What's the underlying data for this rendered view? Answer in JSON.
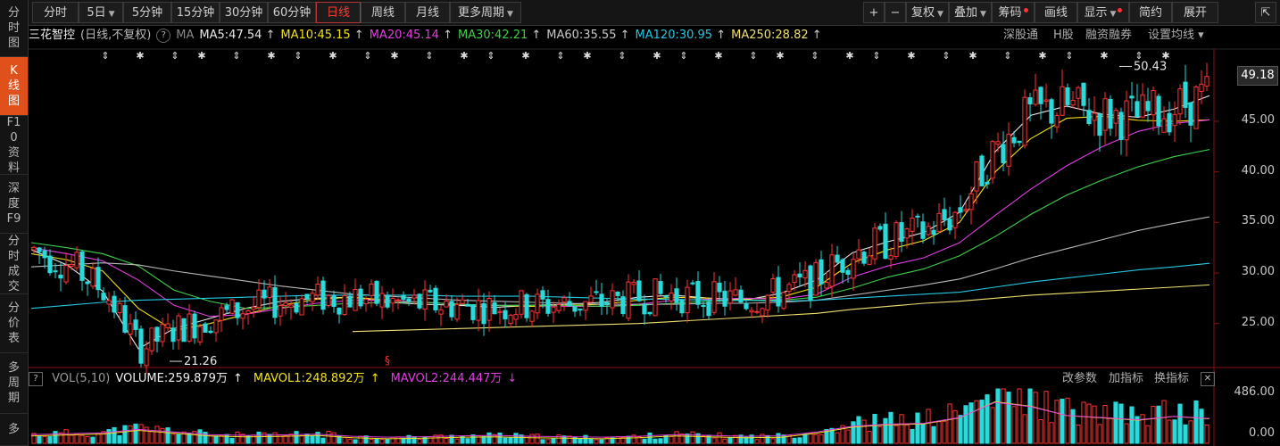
{
  "left_nav": [
    {
      "label": "分时图"
    },
    {
      "label": "K线图",
      "active": true
    },
    {
      "label": "F10资料"
    },
    {
      "label": "深度F9"
    },
    {
      "label": "分时成交"
    },
    {
      "label": "分价表"
    },
    {
      "label": "多周期"
    },
    {
      "label": "多"
    }
  ],
  "toolbar": {
    "periods": [
      "分时",
      "5日",
      "5分钟",
      "15分钟",
      "30分钟",
      "60分钟",
      "日线",
      "周线",
      "月线",
      "更多周期"
    ],
    "active_period": "日线",
    "right_buttons": [
      "+",
      "−",
      "复权",
      "叠加",
      "筹码",
      "画线",
      "显示",
      "简约",
      "展开"
    ]
  },
  "ma_line": {
    "stock_name": "三花智控",
    "mode": "(日线,不复权)",
    "help": "?",
    "ma_label": "MA",
    "items": [
      {
        "text": "MA5:47.54",
        "arrow": "↑",
        "color": "#e8e8e8"
      },
      {
        "text": "MA10:45.15",
        "arrow": "↑",
        "color": "#f2e21c"
      },
      {
        "text": "MA20:45.14",
        "arrow": "↑",
        "color": "#e23ee2"
      },
      {
        "text": "MA30:42.21",
        "arrow": "↑",
        "color": "#3ed24a"
      },
      {
        "text": "MA60:35.55",
        "arrow": "↑",
        "color": "#c8c8c8"
      },
      {
        "text": "MA120:30.95",
        "arrow": "↑",
        "color": "#24c8e0"
      },
      {
        "text": "MA250:28.82",
        "arrow": "↑",
        "color": "#f0e070"
      }
    ],
    "right_links": [
      "深股通",
      "H股",
      "融资融券",
      "设置均线"
    ]
  },
  "price_axis": [
    "45.00",
    "40.00",
    "35.00",
    "30.00",
    "25.00"
  ],
  "current_price": "49.18",
  "annotations": {
    "high": "50.43",
    "low": "21.26"
  },
  "volume_header": {
    "label": "VOL(5,10)",
    "volume": "VOLUME:259.879万",
    "mavol1": "MAVOL1:248.892万",
    "mavol2": "MAVOL2:244.447万",
    "arrow_up": "↑",
    "arrow_down": "↓",
    "right_links": [
      "改参数",
      "加指标",
      "换指标"
    ],
    "close": "✕"
  },
  "volume_axis": [
    "486.00",
    "0.00"
  ],
  "chart_data": {
    "type": "candlestick",
    "ylim": [
      21,
      51
    ],
    "events_glyph": "§",
    "high_close_annot": 50.43,
    "low_annot": 21.26,
    "ma": {
      "MA5": [
        32.3,
        30.8,
        28.2,
        22.5,
        24.5,
        25.5,
        26.5,
        27.2,
        27.5,
        27.6,
        27.1,
        26.9,
        26.8,
        26.6,
        26.8,
        26.9,
        27.1,
        27.6,
        27.8,
        27.5,
        27.3,
        28.0,
        29.3,
        32.0,
        33.1,
        34.0,
        36.0,
        42.0,
        45.6,
        46.5,
        45.7,
        45.4,
        46.2,
        47.54
      ],
      "MA10": [
        31.9,
        31.3,
        30.2,
        26.5,
        24.3,
        25.0,
        25.9,
        26.8,
        27.4,
        27.6,
        27.3,
        27.1,
        26.9,
        26.8,
        26.7,
        26.8,
        26.9,
        27.3,
        27.6,
        27.5,
        27.4,
        27.6,
        28.6,
        31.0,
        32.3,
        33.2,
        35.0,
        40.0,
        43.3,
        45.3,
        45.5,
        45.1,
        45.0,
        45.15
      ],
      "MA20": [
        32.5,
        31.9,
        31.2,
        29.3,
        26.8,
        25.7,
        25.9,
        26.5,
        27.0,
        27.3,
        27.3,
        27.1,
        26.9,
        26.8,
        26.8,
        26.7,
        26.7,
        26.9,
        27.3,
        27.4,
        27.5,
        27.4,
        27.9,
        29.6,
        30.7,
        31.5,
        33.0,
        35.7,
        38.3,
        40.6,
        42.5,
        44.0,
        44.8,
        45.14
      ],
      "MA30": [
        33.0,
        32.5,
        31.9,
        30.7,
        28.3,
        27.2,
        26.5,
        26.6,
        26.8,
        27.0,
        27.1,
        27.1,
        26.9,
        26.8,
        26.8,
        26.8,
        26.7,
        26.8,
        27.0,
        27.2,
        27.3,
        27.3,
        27.6,
        28.5,
        29.6,
        30.4,
        31.7,
        33.6,
        35.8,
        37.7,
        39.2,
        40.5,
        41.5,
        42.21
      ],
      "MA60": [
        30.6,
        30.8,
        31.0,
        30.8,
        30.2,
        29.7,
        29.2,
        28.7,
        28.3,
        27.9,
        27.7,
        27.5,
        27.3,
        27.2,
        27.1,
        27.0,
        26.9,
        26.9,
        26.9,
        27.0,
        27.0,
        27.1,
        27.3,
        27.8,
        28.3,
        28.8,
        29.4,
        30.4,
        31.5,
        32.4,
        33.3,
        34.2,
        34.9,
        35.55
      ],
      "MA120": [
        26.5,
        26.8,
        27.1,
        27.3,
        27.4,
        27.5,
        27.6,
        27.7,
        27.8,
        27.8,
        27.8,
        27.8,
        27.7,
        27.7,
        27.7,
        27.6,
        27.5,
        27.4,
        27.4,
        27.3,
        27.3,
        27.2,
        27.3,
        27.5,
        27.7,
        27.9,
        28.1,
        28.6,
        29.1,
        29.5,
        29.9,
        30.3,
        30.6,
        30.95
      ],
      "MA250": [
        null,
        null,
        null,
        null,
        null,
        null,
        null,
        null,
        null,
        24.2,
        24.3,
        24.4,
        24.5,
        24.6,
        24.7,
        24.8,
        24.9,
        25.0,
        25.2,
        25.4,
        25.6,
        25.8,
        26.0,
        26.4,
        26.7,
        27.0,
        27.2,
        27.5,
        27.8,
        28.0,
        28.2,
        28.4,
        28.6,
        28.82
      ]
    },
    "volume_profile": [
      0.16,
      0.18,
      0.2,
      0.28,
      0.22,
      0.16,
      0.14,
      0.15,
      0.17,
      0.12,
      0.1,
      0.11,
      0.13,
      0.14,
      0.12,
      0.11,
      0.1,
      0.12,
      0.16,
      0.14,
      0.12,
      0.13,
      0.22,
      0.35,
      0.4,
      0.42,
      0.55,
      0.9,
      0.8,
      0.6,
      0.55,
      0.5,
      0.58,
      0.53
    ]
  }
}
